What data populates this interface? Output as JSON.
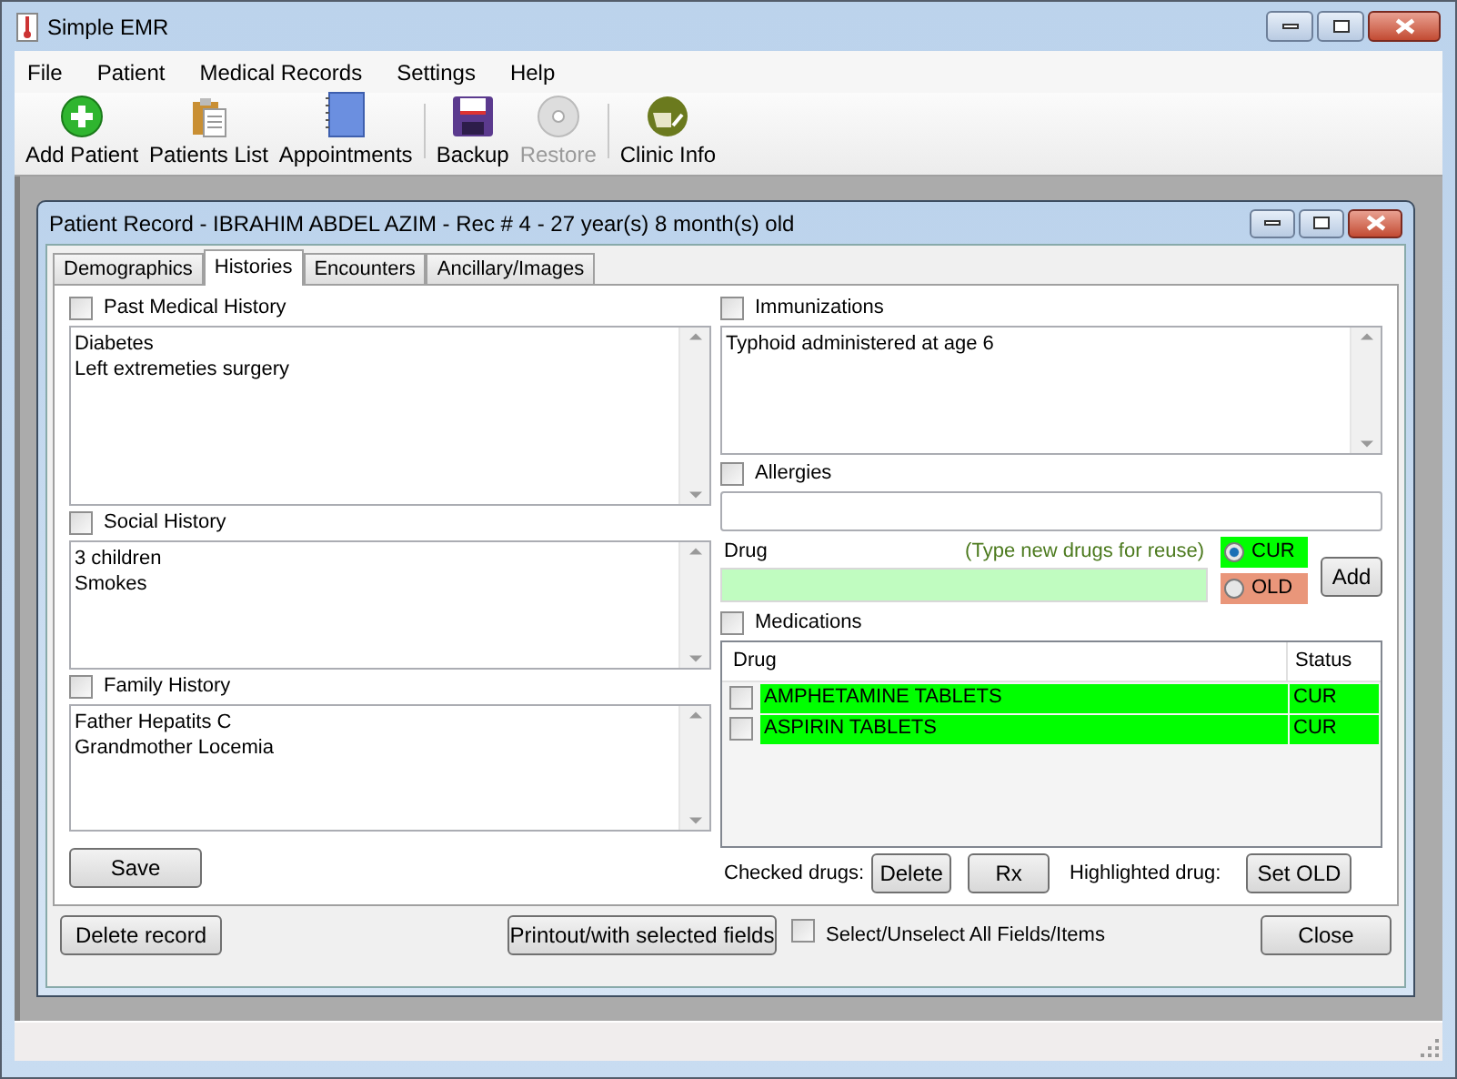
{
  "window": {
    "title": "Simple EMR"
  },
  "menu": [
    "File",
    "Patient",
    "Medical Records",
    "Settings",
    "Help"
  ],
  "toolbar": [
    {
      "label": "Add Patient",
      "kind": "add",
      "disabled": false
    },
    {
      "label": "Patients List",
      "kind": "list",
      "disabled": false
    },
    {
      "label": "Appointments",
      "kind": "notebook",
      "disabled": false
    },
    {
      "label": "Backup",
      "kind": "backup",
      "disabled": false
    },
    {
      "label": "Restore",
      "kind": "restore",
      "disabled": true
    },
    {
      "label": "Clinic Info",
      "kind": "clinic",
      "disabled": false
    }
  ],
  "record": {
    "title": "Patient Record - IBRAHIM ABDEL AZIM - Rec # 4 - 27 year(s) 8 month(s) old",
    "tabs": [
      {
        "label": "Demographics",
        "selected": false
      },
      {
        "label": "Histories",
        "selected": true
      },
      {
        "label": "Encounters",
        "selected": false
      },
      {
        "label": "Ancillary/Images",
        "selected": false
      }
    ],
    "left_sections": [
      {
        "label": "Past Medical History",
        "checked": false,
        "lines": [
          "Diabetes",
          "Left extremeties surgery"
        ]
      },
      {
        "label": "Social History",
        "checked": false,
        "lines": [
          "3 children",
          "Smokes"
        ]
      },
      {
        "label": "Family History",
        "checked": false,
        "lines": [
          "Father Hepatits C",
          "Grandmother Locemia"
        ]
      }
    ],
    "save_button": "Save",
    "immunizations": {
      "label": "Immunizations",
      "checked": false,
      "lines": [
        "Typhoid administered at age 6"
      ]
    },
    "allergies": {
      "label": "Allergies",
      "checked": false
    },
    "drug": {
      "label": "Drug",
      "hint": "(Type new drugs for reuse)"
    },
    "status_options": [
      {
        "label": "CUR",
        "selected": true,
        "color": "#00ff00"
      },
      {
        "label": "OLD",
        "selected": false,
        "color": "#e9967a"
      }
    ],
    "add_button": "Add",
    "medications": {
      "label": "Medications",
      "checked": false,
      "columns": [
        "Drug",
        "Status"
      ],
      "rows": [
        {
          "drug": "AMPHETAMINE TABLETS",
          "status": "CUR",
          "checked": false,
          "color": "#00ff00"
        },
        {
          "drug": "ASPIRIN TABLETS",
          "status": "CUR",
          "checked": false,
          "color": "#00ff00"
        }
      ]
    },
    "checked_drugs_label": "Checked drugs:",
    "delete_button": "Delete",
    "rx_button": "Rx",
    "highlighted_drug_label": "Highlighted drug:",
    "set_old_button": "Set OLD",
    "delete_record_button": "Delete record",
    "printout_button": "Printout/with selected fields",
    "select_all": {
      "label": "Select/Unselect All Fields/Items",
      "checked": false
    },
    "close_button": "Close"
  }
}
